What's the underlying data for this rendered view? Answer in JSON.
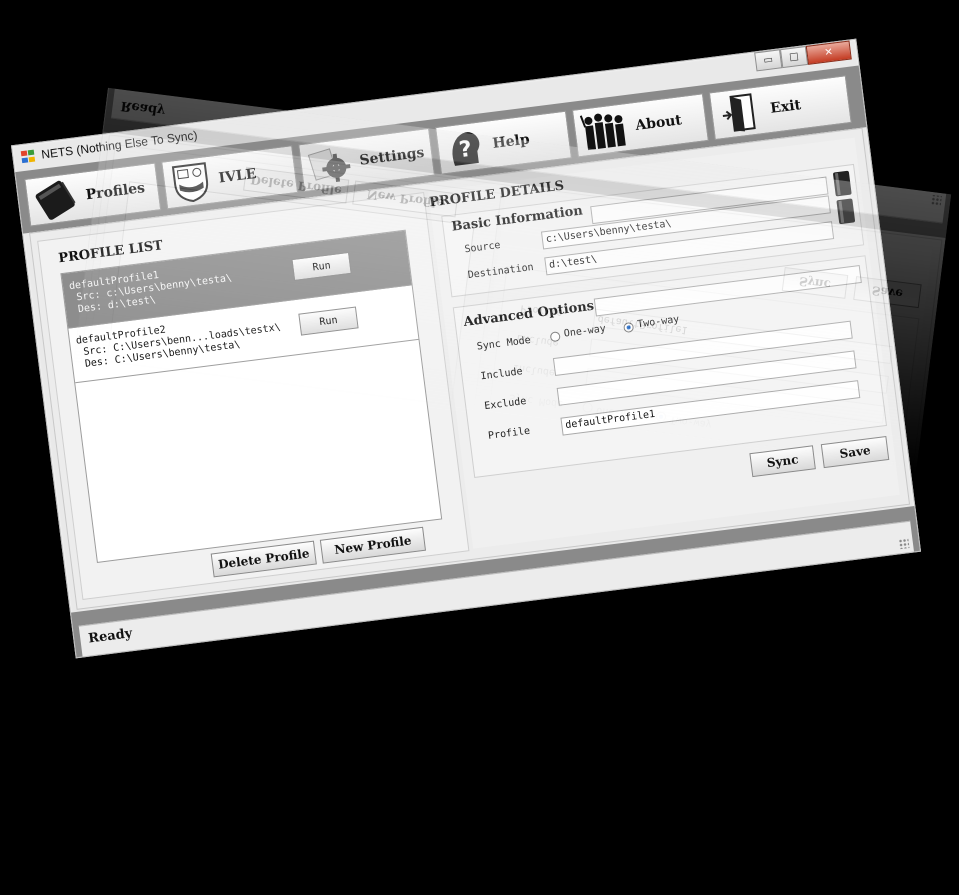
{
  "window": {
    "title": "NETS (Nothing Else To Sync)"
  },
  "title_controls": {
    "minimize": "▭",
    "maximize": "□",
    "close": "✕"
  },
  "tabs": [
    {
      "label": "Profiles",
      "icon": "notebook-icon"
    },
    {
      "label": "IVLE",
      "icon": "crest-icon"
    },
    {
      "label": "Settings",
      "icon": "gear-icon"
    },
    {
      "label": "Help",
      "icon": "question-head-icon"
    },
    {
      "label": "About",
      "icon": "people-icon"
    },
    {
      "label": "Exit",
      "icon": "door-exit-icon"
    }
  ],
  "profile_list": {
    "title": "PROFILE LIST",
    "items": [
      {
        "name": "defaultProfile1",
        "src": " Src: c:\\Users\\benny\\testa\\",
        "des": " Des: d:\\test\\",
        "run_label": "Run",
        "selected": true
      },
      {
        "name": "defaultProfile2",
        "src": " Src: C:\\Users\\benn...loads\\testx\\",
        "des": " Des: C:\\Users\\benny\\testa\\",
        "run_label": "Run",
        "selected": false
      }
    ],
    "delete_label": "Delete Profile",
    "new_label": "New Profile"
  },
  "profile_details": {
    "title": "PROFILE DETAILS",
    "basic": {
      "title": "Basic Information",
      "source_label": "Source",
      "source_value": "c:\\Users\\benny\\testa\\",
      "destination_label": "Destination",
      "destination_value": "d:\\test\\"
    },
    "advanced": {
      "title": "Advanced Options",
      "sync_mode_label": "Sync Mode",
      "one_way": "One-way",
      "two_way": "Two-way",
      "selected_mode": "Two-way",
      "include_label": "Include",
      "include_value": "",
      "exclude_label": "Exclude",
      "exclude_value": "",
      "profile_label": "Profile",
      "profile_value": "defaultProfile1"
    },
    "sync_label": "Sync",
    "save_label": "Save"
  },
  "status": {
    "text": "Ready"
  },
  "colors": {
    "frame": "#8a8a8a",
    "selected_row": "#8d8d8d",
    "close_button": "#c43b22",
    "radio_dot": "#2a6fc9"
  }
}
